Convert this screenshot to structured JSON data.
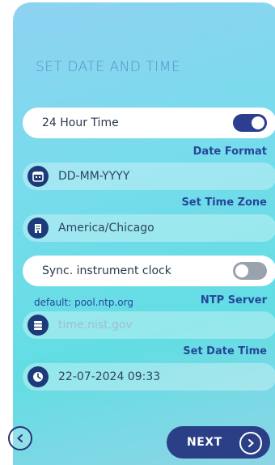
{
  "screen": {
    "title": "SET DATE AND TIME"
  },
  "hour24": {
    "label": "24 Hour Time",
    "enabled": true
  },
  "date_format": {
    "label": "Date Format",
    "value": "DD-MM-YYYY",
    "icon": "calendar-icon"
  },
  "time_zone": {
    "label": "Set Time Zone",
    "value": "America/Chicago",
    "icon": "building-icon"
  },
  "sync_clock": {
    "label": "Sync. instrument clock",
    "enabled": false
  },
  "ntp": {
    "default_hint": "default: pool.ntp.org",
    "label": "NTP Server",
    "placeholder": "time.nist.gov",
    "icon": "server-icon"
  },
  "date_time": {
    "label": "Set Date Time",
    "value": "22-07-2024 09:33",
    "icon": "clock-icon"
  },
  "footer": {
    "next_label": "NEXT"
  },
  "colors": {
    "accent": "#2a3f86",
    "label": "#26479a",
    "title": "#5b8fc7"
  }
}
